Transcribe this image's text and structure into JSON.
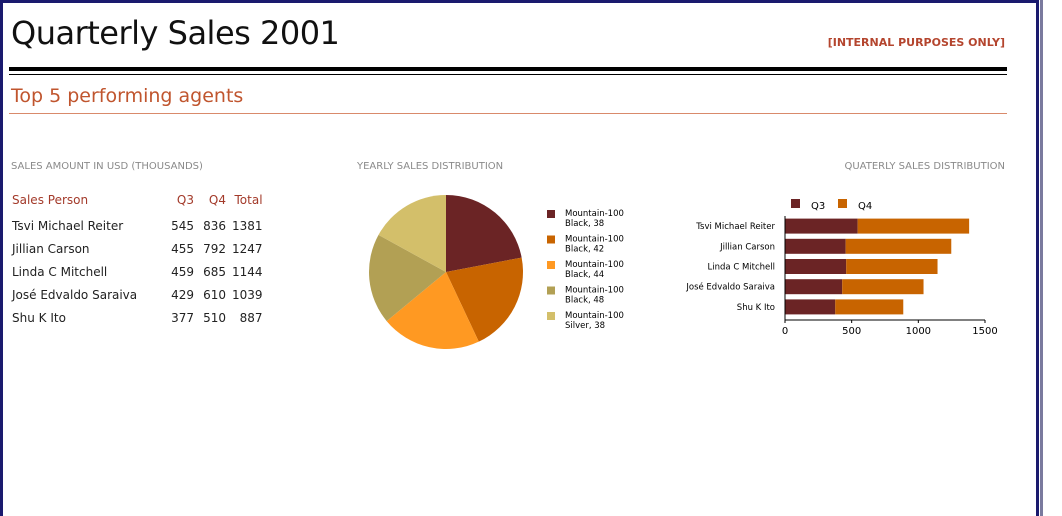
{
  "report": {
    "title": "Quarterly Sales 2001",
    "notice": "[INTERNAL PURPOSES ONLY]",
    "subtitle": "Top 5 performing agents"
  },
  "table_section": {
    "label": "SALES AMOUNT IN USD (THOUSANDS)",
    "headers": {
      "name": "Sales Person",
      "q3": "Q3",
      "q4": "Q4",
      "total": "Total"
    },
    "rows": [
      {
        "name": "Tsvi Michael Reiter",
        "q3": "545",
        "q4": "836",
        "total": "1381"
      },
      {
        "name": "Jillian  Carson",
        "q3": "455",
        "q4": "792",
        "total": "1247"
      },
      {
        "name": "Linda C Mitchell",
        "q3": "459",
        "q4": "685",
        "total": "1144"
      },
      {
        "name": "José Edvaldo Saraiva",
        "q3": "429",
        "q4": "610",
        "total": "1039"
      },
      {
        "name": "Shu K Ito",
        "q3": "377",
        "q4": "510",
        "total": "887"
      }
    ]
  },
  "pie_section": {
    "label": "YEARLY SALES DISTRIBUTION"
  },
  "bar_section": {
    "label": "QUATERLY SALES DISTRIBUTION"
  },
  "colors": {
    "q3": "#6b2425",
    "q4": "#c86400",
    "accent": "#c0552e"
  },
  "chart_data": [
    {
      "type": "pie",
      "title": "YEARLY SALES DISTRIBUTION",
      "slices": [
        {
          "label": [
            "Mountain-100",
            "Black, 38"
          ],
          "value": 22,
          "color": "#6b2425"
        },
        {
          "label": [
            "Mountain-100",
            "Black, 42"
          ],
          "value": 21,
          "color": "#c86400"
        },
        {
          "label": [
            "Mountain-100",
            "Black, 44"
          ],
          "value": 21,
          "color": "#ff9922"
        },
        {
          "label": [
            "Mountain-100",
            "Black, 48"
          ],
          "value": 19,
          "color": "#b2a054"
        },
        {
          "label": [
            "Mountain-100",
            "Silver, 38"
          ],
          "value": 17,
          "color": "#d3bf6a"
        }
      ]
    },
    {
      "type": "bar",
      "orientation": "horizontal",
      "stacked": true,
      "title": "QUATERLY SALES DISTRIBUTION",
      "categories": [
        "Tsvi Michael Reiter",
        "Jillian  Carson",
        "Linda C Mitchell",
        "José Edvaldo Saraiva",
        "Shu K Ito"
      ],
      "series": [
        {
          "name": "Q3",
          "values": [
            545,
            455,
            459,
            429,
            377
          ],
          "color": "#6b2425"
        },
        {
          "name": "Q4",
          "values": [
            836,
            792,
            685,
            610,
            510
          ],
          "color": "#c86400"
        }
      ],
      "xlim": [
        0,
        1500
      ],
      "xticks": [
        0,
        500,
        1000,
        1500
      ],
      "legend": "top"
    }
  ]
}
